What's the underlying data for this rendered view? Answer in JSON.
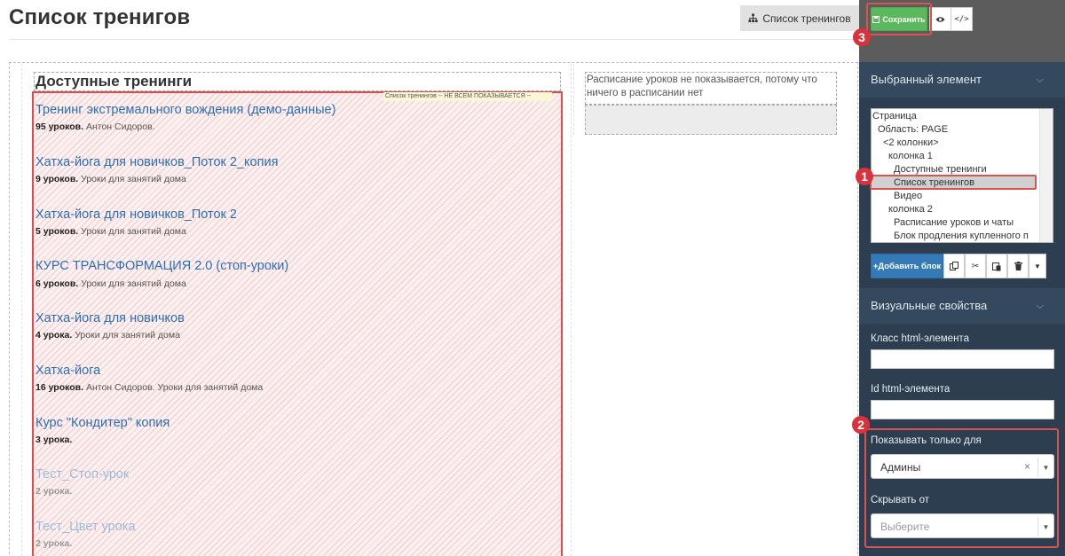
{
  "header": {
    "title": "Список тренигов",
    "list_button": "Список тренингов",
    "save_button": "Сохранить"
  },
  "canvas": {
    "available_title": "Доступные тренинги",
    "list_tag": "Список тренингов -- НЕ ВСЕМ ПОКАЗЫВАЕТСЯ --",
    "trainings": [
      {
        "title": "Тренинг экстремального вождения (демо-данные)",
        "count": "95 уроков.",
        "info": " Антон Сидоров."
      },
      {
        "title": "Хатха-йога для новичков_Поток 2_копия",
        "count": "9 уроков.",
        "info": " Уроки для занятий дома"
      },
      {
        "title": "Хатха-йога для новичков_Поток 2",
        "count": "5 уроков.",
        "info": " Уроки для занятий дома"
      },
      {
        "title": "КУРС ТРАНСФОРМАЦИЯ 2.0 (стоп-уроки)",
        "count": "6 уроков.",
        "info": " Уроки для занятий дома"
      },
      {
        "title": "Хатха-йога для новичков",
        "count": "4 урока.",
        "info": " Уроки для занятий дома"
      },
      {
        "title": "Хатха-йога",
        "count": "16 уроков.",
        "info": " Антон Сидоров. Уроки для занятий дома"
      },
      {
        "title": "Курс \"Кондитер\" копия",
        "count": "3 урока.",
        "info": ""
      },
      {
        "title": "Тест_Стоп-урок",
        "count": "2 урока.",
        "info": ""
      },
      {
        "title": "Тест_Цвет урока",
        "count": "2 урока.",
        "info": ""
      }
    ],
    "schedule_text": "Расписание уроков не показывается, потому что ничего в расписании нет"
  },
  "panel": {
    "selected_title": "Выбранный элемент",
    "tree": [
      "Страница",
      "Область: PAGE",
      "<2 колонки>",
      "колонка 1",
      "Доступные тренинги",
      "Список тренингов",
      "Видео",
      "колонка 2",
      "Расписание уроков и чаты",
      "Блок продления купленного п"
    ],
    "add_block": "+Добавить блок",
    "visual_title": "Визуальные свойства",
    "class_label": "Класс html-элемента",
    "id_label": "Id html-элемента",
    "show_only_label": "Показывать только для",
    "show_only_value": "Админы",
    "hide_from_label": "Скрывать от",
    "hide_from_placeholder": "Выберите"
  },
  "callouts": [
    "1",
    "2",
    "3"
  ],
  "colors": {
    "save": "#5cb85c",
    "accent": "#337ab7",
    "highlight": "#d9534f",
    "panel": "#2d3e50"
  },
  "icons": [
    "sitemap-icon",
    "floppy-icon",
    "eye-icon",
    "code-icon",
    "copy-icon",
    "cut-icon",
    "paste-icon",
    "trash-icon",
    "caret-down-icon",
    "chevron-down-icon",
    "clear-icon"
  ]
}
